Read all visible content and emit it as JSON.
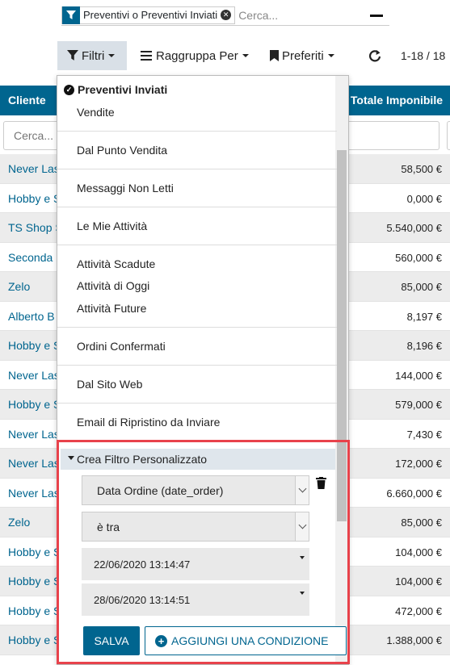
{
  "search": {
    "facet_value": "Preventivi o Preventivi Inviati",
    "placeholder": "Cerca..."
  },
  "controls": {
    "filters_label": "Filtri",
    "group_label": "Raggruppa Per",
    "favorites_label": "Preferiti",
    "pager": "1-18 / 18"
  },
  "table": {
    "columns": {
      "client": "Cliente",
      "total": "Totale Imponibile"
    },
    "filter_placeholder": "Cerca...",
    "rows": [
      {
        "client": "Never Last",
        "total": "58,500 €"
      },
      {
        "client": "Hobby e Sport",
        "total": "0,000 €"
      },
      {
        "client": "TS Shop S",
        "total": "5.540,000 €"
      },
      {
        "client": "Seconda Mano",
        "total": "560,000 €"
      },
      {
        "client": "Zelo",
        "total": "85,000 €"
      },
      {
        "client": "Alberto B",
        "total": "8,197 €"
      },
      {
        "client": "Hobby e Sport",
        "total": "8,196 €"
      },
      {
        "client": "Never Last",
        "total": "144,000 €"
      },
      {
        "client": "Hobby e Sport",
        "total": "579,000 €"
      },
      {
        "client": "Never Last",
        "total": "7,430 €"
      },
      {
        "client": "Never Last",
        "total": "172,000 €"
      },
      {
        "client": "Never Last",
        "total": "6.660,000 €"
      },
      {
        "client": "Zelo",
        "total": "85,000 €"
      },
      {
        "client": "Hobby e Sport",
        "total": "104,000 €"
      },
      {
        "client": "Hobby e Sport",
        "total": "104,000 €"
      },
      {
        "client": "Hobby e Sport",
        "total": "472,000 €"
      },
      {
        "client": "Hobby e Sport",
        "total": "1.388,000 €"
      }
    ]
  },
  "dropdown": {
    "checked": "Preventivi Inviati",
    "items": {
      "vendite": "Vendite",
      "punto_vendita": "Dal Punto Vendita",
      "messaggi": "Messaggi Non Letti",
      "mie_attivita": "Le Mie Attività",
      "scadute": "Attività Scadute",
      "oggi": "Attività di Oggi",
      "future": "Attività Future",
      "ordini": "Ordini Confermati",
      "sito": "Dal Sito Web",
      "email": "Email di Ripristino da Inviare"
    },
    "custom": {
      "header": "Crea Filtro Personalizzato",
      "field": "Data Ordine (date_order)",
      "operator": "è tra",
      "date_from": "22/06/2020 13:14:47",
      "date_to": "28/06/2020 13:14:51",
      "save_label": "SALVA",
      "add_label": "AGGIUNGI UNA CONDIZIONE"
    }
  },
  "colors": {
    "primary": "#00658f",
    "highlight": "#e8424b"
  }
}
